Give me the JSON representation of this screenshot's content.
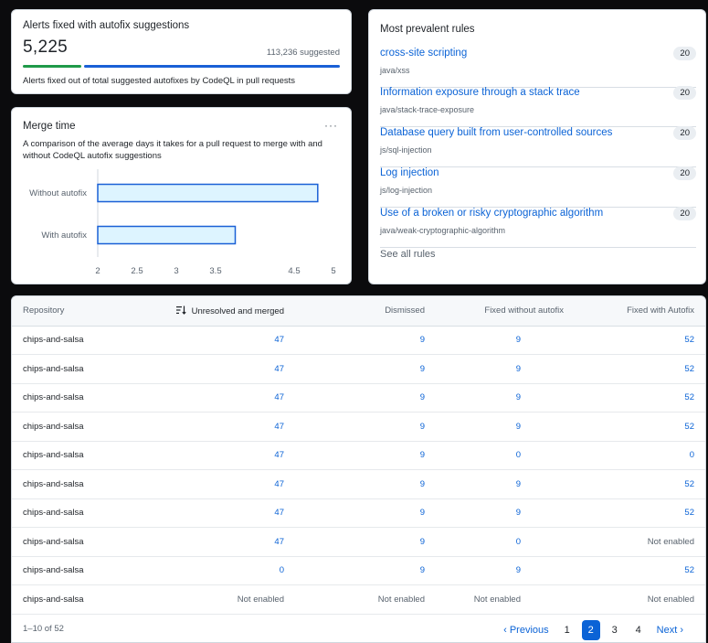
{
  "alerts": {
    "title": "Alerts fixed with autofix suggestions",
    "fixed_count": "5,225",
    "suggested_label": "113,236 suggested",
    "fixed_value": 5225,
    "suggested_value": 113236,
    "description": "Alerts fixed out of total suggested autofixes by CodeQL in pull requests",
    "colors": {
      "fixed": "#1f9a49",
      "suggested": "#1a60d6"
    }
  },
  "merge": {
    "title": "Merge time",
    "menu_icon": "kebab-horizontal-icon",
    "description": "A comparison of the average days it takes for a pull request to merge with and without CodeQL autofix suggestions"
  },
  "chart_data": {
    "type": "bar",
    "orientation": "horizontal",
    "categories": [
      "Without autofix",
      "With autofix"
    ],
    "values": [
      4.8,
      3.75
    ],
    "xlim": [
      2,
      5
    ],
    "xticks": [
      "2",
      "2.5",
      "3",
      "3.5",
      "4.5",
      "5"
    ],
    "xtick_values": [
      2,
      2.5,
      3,
      3.5,
      4.5,
      5
    ],
    "grid": false,
    "colors": {
      "fill": "#ddf4ff",
      "stroke": "#1a60d6"
    }
  },
  "rules": {
    "title": "Most prevalent rules",
    "items": [
      {
        "name": "cross-site scripting",
        "id": "java/xss",
        "count": "20"
      },
      {
        "name": "Information exposure through a stack trace",
        "id": "java/stack-trace-exposure",
        "count": "20"
      },
      {
        "name": "Database query built from user-controlled sources",
        "id": "js/sql-injection",
        "count": "20"
      },
      {
        "name": "Log injection",
        "id": "js/log-injection",
        "count": "20"
      },
      {
        "name": "Use of a broken or risky cryptographic algorithm",
        "id": "java/weak-cryptographic-algorithm",
        "count": "20"
      }
    ],
    "see_all": "See all rules"
  },
  "table": {
    "sort_icon": "sort-desc-icon",
    "headers": {
      "repository": "Repository",
      "unresolved": "Unresolved and merged",
      "dismissed": "Dismissed",
      "fixed_without": "Fixed without autofix",
      "fixed_with": "Fixed with Autofix"
    },
    "rows": [
      [
        "chips-and-salsa",
        "47",
        "9",
        "9",
        "52"
      ],
      [
        "chips-and-salsa",
        "47",
        "9",
        "9",
        "52"
      ],
      [
        "chips-and-salsa",
        "47",
        "9",
        "9",
        "52"
      ],
      [
        "chips-and-salsa",
        "47",
        "9",
        "9",
        "52"
      ],
      [
        "chips-and-salsa",
        "47",
        "9",
        "0",
        "0"
      ],
      [
        "chips-and-salsa",
        "47",
        "9",
        "9",
        "52"
      ],
      [
        "chips-and-salsa",
        "47",
        "9",
        "9",
        "52"
      ],
      [
        "chips-and-salsa",
        "47",
        "9",
        "0",
        "Not enabled"
      ],
      [
        "chips-and-salsa",
        "0",
        "9",
        "9",
        "52"
      ],
      [
        "chips-and-salsa",
        "Not enabled",
        "Not enabled",
        "Not enabled",
        "Not enabled"
      ]
    ],
    "range": "1–10 of 52",
    "pagination": {
      "previous": "Previous",
      "next": "Next",
      "previous_icon": "chevron-left-icon",
      "next_icon": "chevron-right-icon",
      "pages": [
        "1",
        "2",
        "3",
        "4"
      ],
      "current": "2"
    }
  }
}
